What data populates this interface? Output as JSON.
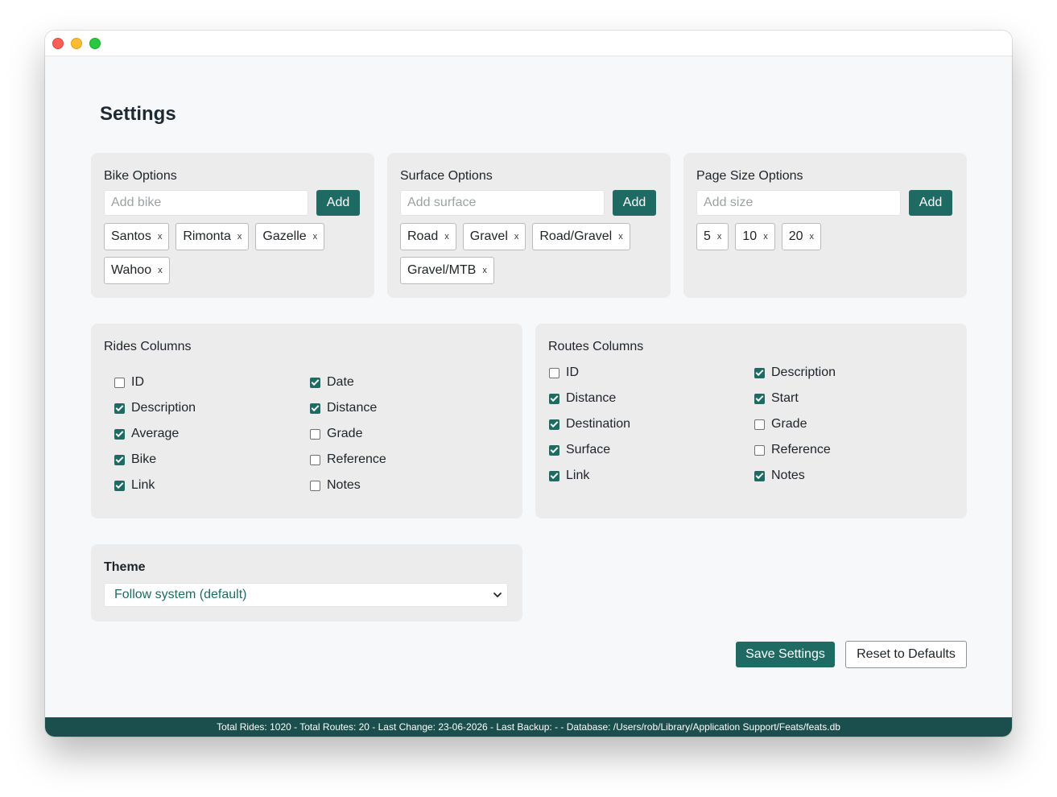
{
  "page": {
    "title": "Settings"
  },
  "bike_options": {
    "title": "Bike Options",
    "placeholder": "Add bike",
    "add_label": "Add",
    "tags": [
      "Santos",
      "Rimonta",
      "Gazelle",
      "Wahoo"
    ]
  },
  "surface_options": {
    "title": "Surface Options",
    "placeholder": "Add surface",
    "add_label": "Add",
    "tags": [
      "Road",
      "Gravel",
      "Road/Gravel",
      "Gravel/MTB"
    ]
  },
  "page_size_options": {
    "title": "Page Size Options",
    "placeholder": "Add size",
    "add_label": "Add",
    "tags": [
      "5",
      "10",
      "20"
    ]
  },
  "tag_remove_glyph": "x",
  "rides_columns": {
    "title": "Rides Columns",
    "items": [
      {
        "label": "ID",
        "checked": false
      },
      {
        "label": "Date",
        "checked": true
      },
      {
        "label": "Description",
        "checked": true
      },
      {
        "label": "Distance",
        "checked": true
      },
      {
        "label": "Average",
        "checked": true
      },
      {
        "label": "Grade",
        "checked": false
      },
      {
        "label": "Bike",
        "checked": true
      },
      {
        "label": "Reference",
        "checked": false
      },
      {
        "label": "Link",
        "checked": true
      },
      {
        "label": "Notes",
        "checked": false
      }
    ]
  },
  "routes_columns": {
    "title": "Routes Columns",
    "items": [
      {
        "label": "ID",
        "checked": false
      },
      {
        "label": "Description",
        "checked": true
      },
      {
        "label": "Distance",
        "checked": true
      },
      {
        "label": "Start",
        "checked": true
      },
      {
        "label": "Destination",
        "checked": true
      },
      {
        "label": "Grade",
        "checked": false
      },
      {
        "label": "Surface",
        "checked": true
      },
      {
        "label": "Reference",
        "checked": false
      },
      {
        "label": "Link",
        "checked": true
      },
      {
        "label": "Notes",
        "checked": true
      }
    ]
  },
  "theme": {
    "label": "Theme",
    "selected": "Follow system (default)"
  },
  "actions": {
    "save_label": "Save Settings",
    "reset_label": "Reset to Defaults"
  },
  "status": {
    "text": "Total Rides: 1020 - Total Routes: 20 - Last Change: 23-06-2026 - Last Backup: - - Database: /Users/rob/Library/Application Support/Feats/feats.db"
  },
  "colors": {
    "accent": "#1f6b64",
    "status_bar": "#1b4f4d",
    "card_bg": "#ececed"
  }
}
